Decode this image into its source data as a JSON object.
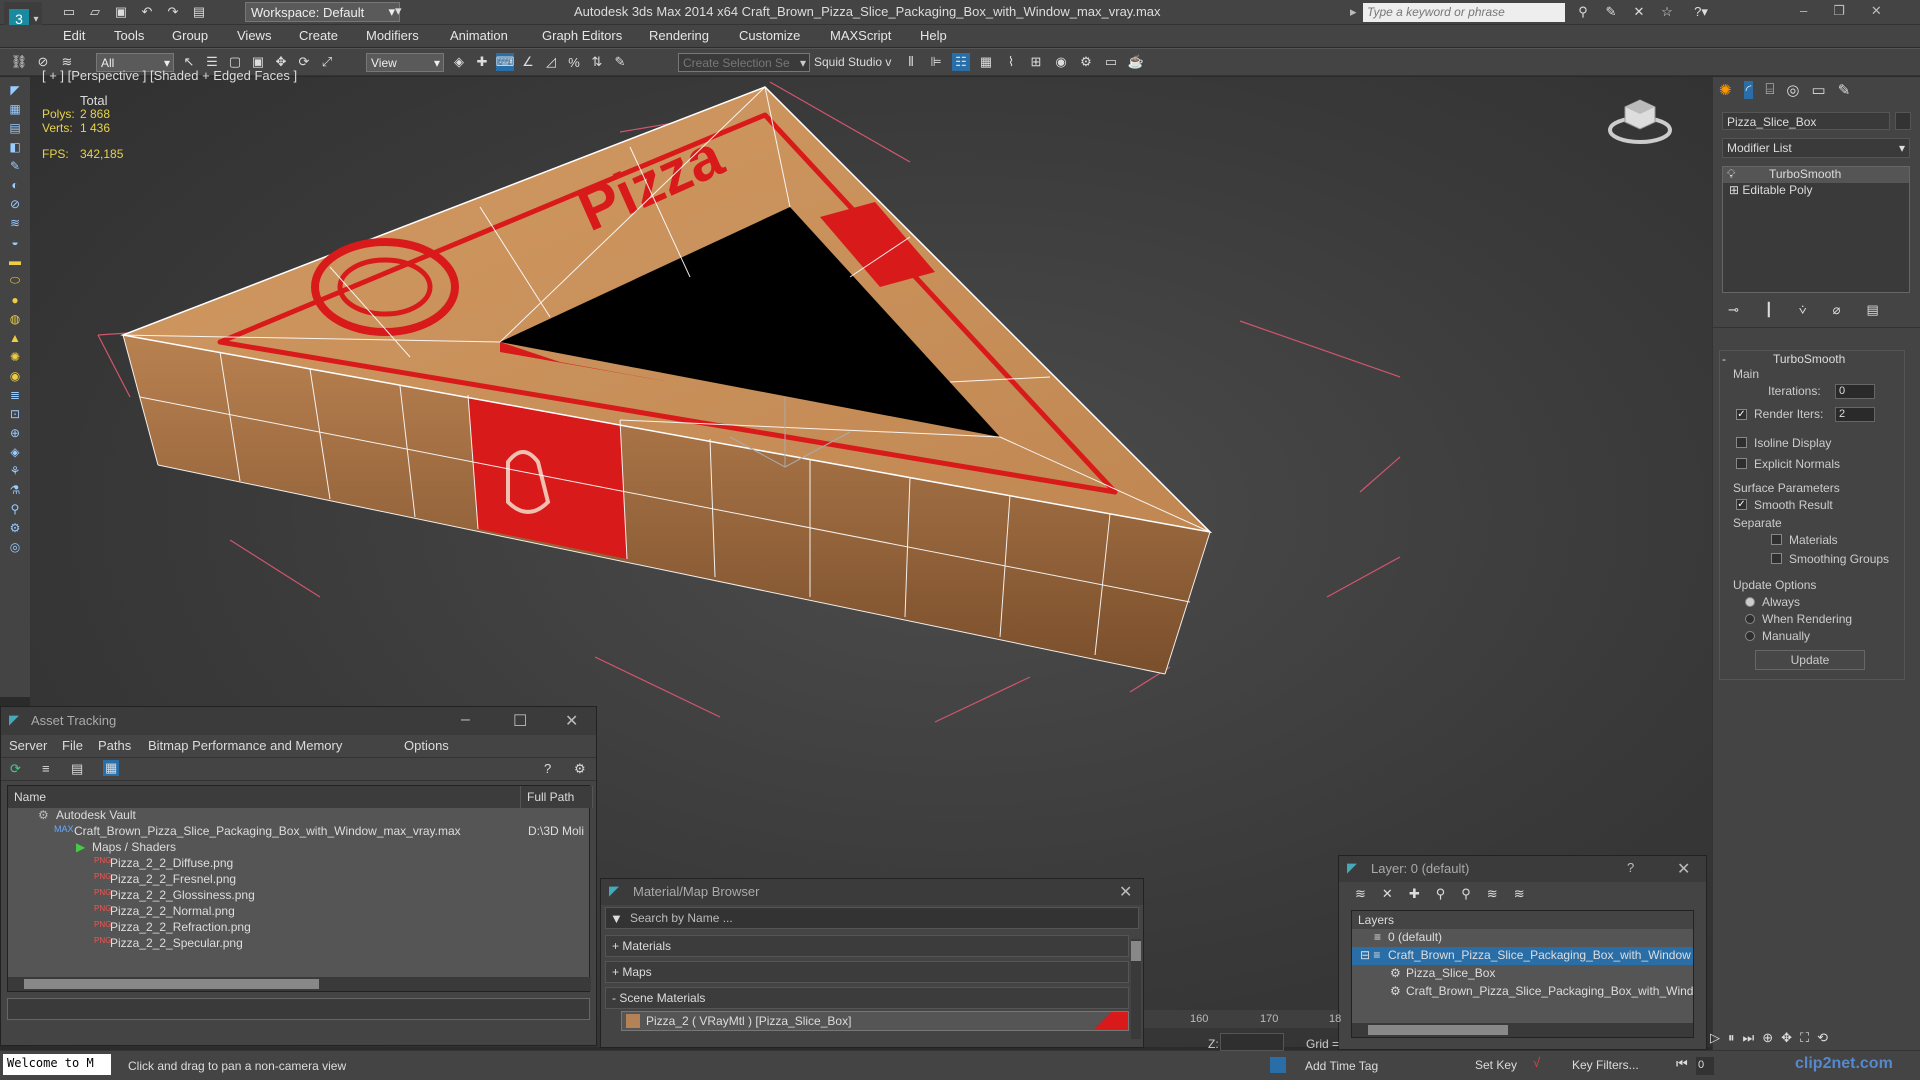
{
  "titlebar": {
    "workspace": "Workspace: Default",
    "window_title": "Autodesk 3ds Max  2014 x64      Craft_Brown_Pizza_Slice_Packaging_Box_with_Window_max_vray.max",
    "search_placeholder": "Type a keyword or phrase"
  },
  "menu": [
    "Edit",
    "Tools",
    "Group",
    "Views",
    "Create",
    "Modifiers",
    "Animation",
    "Graph Editors",
    "Rendering",
    "Customize",
    "MAXScript",
    "Help"
  ],
  "toolbar": {
    "filter": "All",
    "refcoord": "View",
    "selection_set": "Create Selection Se",
    "squid": "Squid Studio v"
  },
  "viewport": {
    "label": "[ + ] [Perspective ] [Shaded + Edged Faces ]",
    "stats_total": "Total",
    "polys_label": "Polys:",
    "polys": "2 868",
    "verts_label": "Verts:",
    "verts": "1 436",
    "fps_label": "FPS:",
    "fps": "342,185"
  },
  "command_panel": {
    "object_name": "Pizza_Slice_Box",
    "modifier_list": "Modifier List",
    "stack": [
      "TurboSmooth",
      "Editable Poly"
    ],
    "turbosmooth_title": "TurboSmooth",
    "main": "Main",
    "iterations_label": "Iterations:",
    "iterations": "0",
    "render_iters_label": "Render Iters:",
    "render_iters": "2",
    "isoline": "Isoline Display",
    "explicit": "Explicit Normals",
    "surface_params": "Surface Parameters",
    "smooth_result": "Smooth Result",
    "separate": "Separate",
    "materials": "Materials",
    "smoothing_groups": "Smoothing Groups",
    "update_options": "Update Options",
    "always": "Always",
    "when_rendering": "When Rendering",
    "manually": "Manually",
    "update": "Update"
  },
  "asset_tracking": {
    "title": "Asset Tracking",
    "menu": [
      "Server",
      "File",
      "Paths",
      "Bitmap Performance and Memory",
      "Options"
    ],
    "col_name": "Name",
    "col_path": "Full Path",
    "rows": [
      {
        "name": "Autodesk Vault",
        "path": ""
      },
      {
        "name": "Craft_Brown_Pizza_Slice_Packaging_Box_with_Window_max_vray.max",
        "path": "D:\\3D Moli"
      },
      {
        "name": "Maps / Shaders",
        "path": ""
      },
      {
        "name": "Pizza_2_2_Diffuse.png",
        "path": ""
      },
      {
        "name": "Pizza_2_2_Fresnel.png",
        "path": ""
      },
      {
        "name": "Pizza_2_2_Glossiness.png",
        "path": ""
      },
      {
        "name": "Pizza_2_2_Normal.png",
        "path": ""
      },
      {
        "name": "Pizza_2_2_Refraction.png",
        "path": ""
      },
      {
        "name": "Pizza_2_2_Specular.png",
        "path": ""
      }
    ]
  },
  "material_browser": {
    "title": "Material/Map Browser",
    "search": "Search by Name ...",
    "sections": [
      "+ Materials",
      "+ Maps",
      "- Scene Materials"
    ],
    "scene_material": "Pizza_2  ( VRayMtl ) [Pizza_Slice_Box]"
  },
  "layer_window": {
    "title": "Layer: 0 (default)",
    "header": "Layers",
    "rows": [
      "0 (default)",
      "Craft_Brown_Pizza_Slice_Packaging_Box_with_Window",
      "Pizza_Slice_Box",
      "Craft_Brown_Pizza_Slice_Packaging_Box_with_Wind"
    ]
  },
  "timeline": {
    "ticks": [
      "160",
      "170",
      "18"
    ]
  },
  "status": {
    "welcome": "Welcome to M",
    "hint": "Click and drag to pan a non-camera view",
    "add_time_tag": "Add Time Tag",
    "set_key": "Set Key",
    "key_filters": "Key Filters...",
    "z_label": "Z:",
    "grid_label": "Grid =",
    "frame": "0",
    "watermark": "clip2net.com"
  },
  "colors": {
    "accent": "#2a6ea8",
    "box_brown": "#c48a55",
    "print_red": "#d91a1a"
  }
}
